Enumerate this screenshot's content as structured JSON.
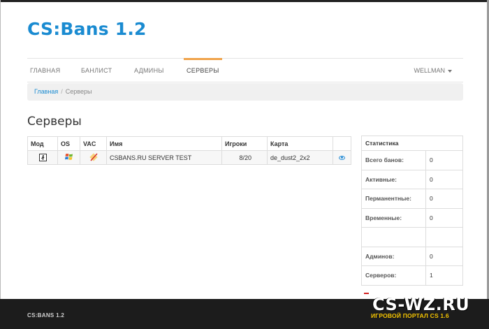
{
  "brand": "CS:Bans 1.2",
  "nav": {
    "items": [
      "ГЛАВНАЯ",
      "БАНЛИСТ",
      "АДМИНЫ",
      "СЕРВЕРЫ"
    ],
    "user": "WELLMAN"
  },
  "breadcrumb": {
    "home": "Главная",
    "separator": "/",
    "current": "Серверы"
  },
  "page_title": "Серверы",
  "servers_table": {
    "columns": [
      "Мод",
      "OS",
      "VAC",
      "Имя",
      "Игроки",
      "Карта"
    ],
    "rows": [
      {
        "mod_icon": "counter-strike-icon",
        "os_icon": "windows-icon",
        "vac_icon": "vac-disabled-icon",
        "name": "CSBANS.RU SERVER TEST",
        "players": "8/20",
        "map": "de_dust2_2x2",
        "view_icon": "eye-icon"
      }
    ]
  },
  "stats": {
    "title": "Статистика",
    "rows": [
      {
        "label": "Всего банов:",
        "value": "0"
      },
      {
        "label": "Активные:",
        "value": "0"
      },
      {
        "label": "Перманентные:",
        "value": "0"
      },
      {
        "label": "Временные:",
        "value": "0"
      },
      {
        "label": "",
        "value": ""
      },
      {
        "label": "Админов:",
        "value": "0"
      },
      {
        "label": "Серверов:",
        "value": "1"
      }
    ]
  },
  "footer": {
    "text": "CS:BANS 1.2"
  },
  "watermark": {
    "main": "CS-WZ.RU",
    "sub": "ИГРОВОЙ ПОРТАЛ CS 1.6"
  },
  "colors": {
    "brand": "#1a8bd1",
    "nav_active": "#f0a34a",
    "footer_bg": "#1c1c1c"
  }
}
